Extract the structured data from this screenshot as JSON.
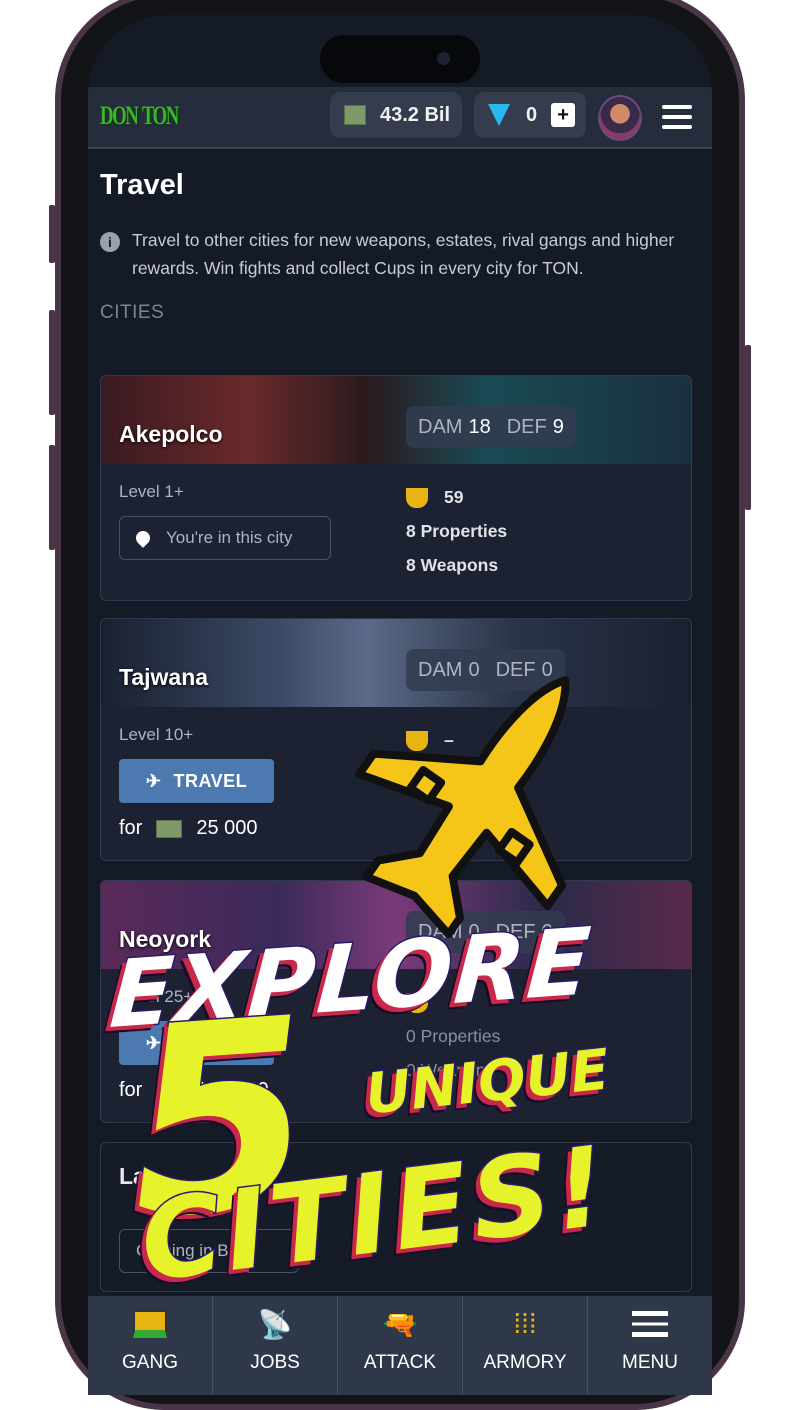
{
  "header": {
    "logo": "DON TON",
    "logo_a": "DON",
    "logo_b": "TON",
    "cash": "43.2 Bil",
    "gems": "0",
    "plus": "+",
    "icons": {
      "cash": "cash-icon",
      "gem": "diamond-icon",
      "menu": "hamburger-icon"
    }
  },
  "page": {
    "title": "Travel",
    "info": "Travel to other cities for new weapons, estates, rival gangs and higher rewards. Win fights and collect Cups in every city for TON.",
    "section": "CITIES"
  },
  "labels": {
    "dam": "DAM",
    "def": "DEF",
    "travel": "TRAVEL",
    "for": "for"
  },
  "cities": [
    {
      "name": "Akepolco",
      "dam": "18",
      "def": "9",
      "level": "Level 1+",
      "status": "You're in this city",
      "cups": "59",
      "properties": "8 Properties",
      "weapons": "8 Weapons"
    },
    {
      "name": "Tajwana",
      "dam": "0",
      "def": "0",
      "level": "Level 10+",
      "cups": "–",
      "cost": "25 000",
      "properties": "0 P"
    },
    {
      "name": "Neoyork",
      "dam": "0",
      "def": "0",
      "level": "Level 25+",
      "cost": "100 000",
      "properties": "0 Properties",
      "weapons": "0 Weapons"
    },
    {
      "name": "La",
      "status": "Coming in B"
    }
  ],
  "nav": [
    {
      "label": "GANG",
      "icon": "gang-icon"
    },
    {
      "label": "JOBS",
      "icon": "antenna-icon"
    },
    {
      "label": "ATTACK",
      "icon": "pistol-icon"
    },
    {
      "label": "ARMORY",
      "icon": "bullets-icon"
    },
    {
      "label": "MENU",
      "icon": "hamburger-icon"
    }
  ],
  "promo": {
    "line1": "EXPLORE",
    "number": "5",
    "line2": "UNIQUE",
    "line3": "CITIES!",
    "colors": {
      "yellow": "#e6f22a",
      "red": "#c8284a",
      "jet": "#f5c518"
    }
  }
}
